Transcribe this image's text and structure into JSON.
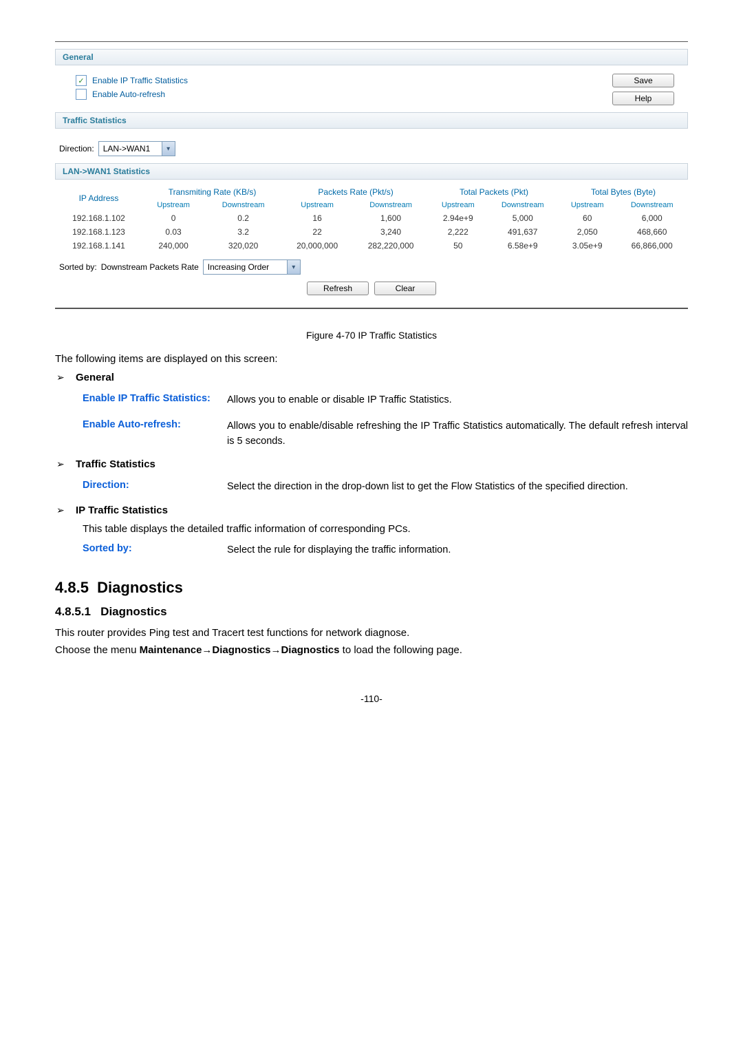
{
  "ui": {
    "general": {
      "title": "General",
      "enable_stats_label": "Enable IP Traffic Statistics",
      "enable_stats_checked": true,
      "enable_refresh_label": "Enable Auto-refresh",
      "enable_refresh_checked": false,
      "save_btn": "Save",
      "help_btn": "Help"
    },
    "traffic_stats": {
      "title": "Traffic Statistics",
      "direction_label": "Direction:",
      "direction_value": "LAN->WAN1"
    },
    "stats_table": {
      "title": "LAN->WAN1 Statistics",
      "ip_header": "IP Address",
      "groups": [
        "Transmiting Rate (KB/s)",
        "Packets Rate (Pkt/s)",
        "Total Packets (Pkt)",
        "Total Bytes (Byte)"
      ],
      "subheaders": [
        "Upstream",
        "Downstream",
        "Upstream",
        "Downstream",
        "Upstream",
        "Downstream",
        "Upstream",
        "Downstream"
      ],
      "rows": [
        {
          "ip": "192.168.1.102",
          "c": [
            "0",
            "0.2",
            "16",
            "1,600",
            "2.94e+9",
            "5,000",
            "60",
            "6,000"
          ]
        },
        {
          "ip": "192.168.1.123",
          "c": [
            "0.03",
            "3.2",
            "22",
            "3,240",
            "2,222",
            "491,637",
            "2,050",
            "468,660"
          ]
        },
        {
          "ip": "192.168.1.141",
          "c": [
            "240,000",
            "320,020",
            "20,000,000",
            "282,220,000",
            "50",
            "6.58e+9",
            "3.05e+9",
            "66,866,000"
          ]
        }
      ],
      "sorted_by_label": "Sorted by:",
      "sorted_by_value": "Downstream Packets Rate",
      "sorted_order_value": "Increasing Order",
      "refresh_btn": "Refresh",
      "clear_btn": "Clear"
    }
  },
  "doc": {
    "fig_caption": "Figure 4-70 IP Traffic Statistics",
    "intro": "The following items are displayed on this screen:",
    "sections": {
      "general": {
        "label": "General",
        "items": [
          {
            "term": "Enable IP Traffic Statistics:",
            "desc": "Allows you to enable or disable IP Traffic Statistics."
          },
          {
            "term": "Enable Auto-refresh:",
            "desc": "Allows you to enable/disable refreshing the IP Traffic Statistics automatically. The default refresh interval is 5 seconds."
          }
        ]
      },
      "traffic": {
        "label": "Traffic Statistics",
        "items": [
          {
            "term": "Direction:",
            "desc": "Select the direction in the drop-down list to get the Flow Statistics of the specified direction."
          }
        ]
      },
      "ip": {
        "label": "IP Traffic Statistics",
        "note": "This table displays the detailed traffic information of corresponding PCs.",
        "items": [
          {
            "term": "Sorted by:",
            "desc": "Select the rule for displaying the traffic information."
          }
        ]
      }
    },
    "h2_num": "4.8.5",
    "h2_title": "Diagnostics",
    "h3_num": "4.8.5.1",
    "h3_title": "Diagnostics",
    "diag_p1": "This router provides Ping test and Tracert test functions for network diagnose.",
    "diag_p2_pre": "Choose the menu ",
    "diag_p2_bold": "Maintenance→Diagnostics→Diagnostics",
    "diag_p2_post": " to load the following page.",
    "page_num": "-110-"
  }
}
